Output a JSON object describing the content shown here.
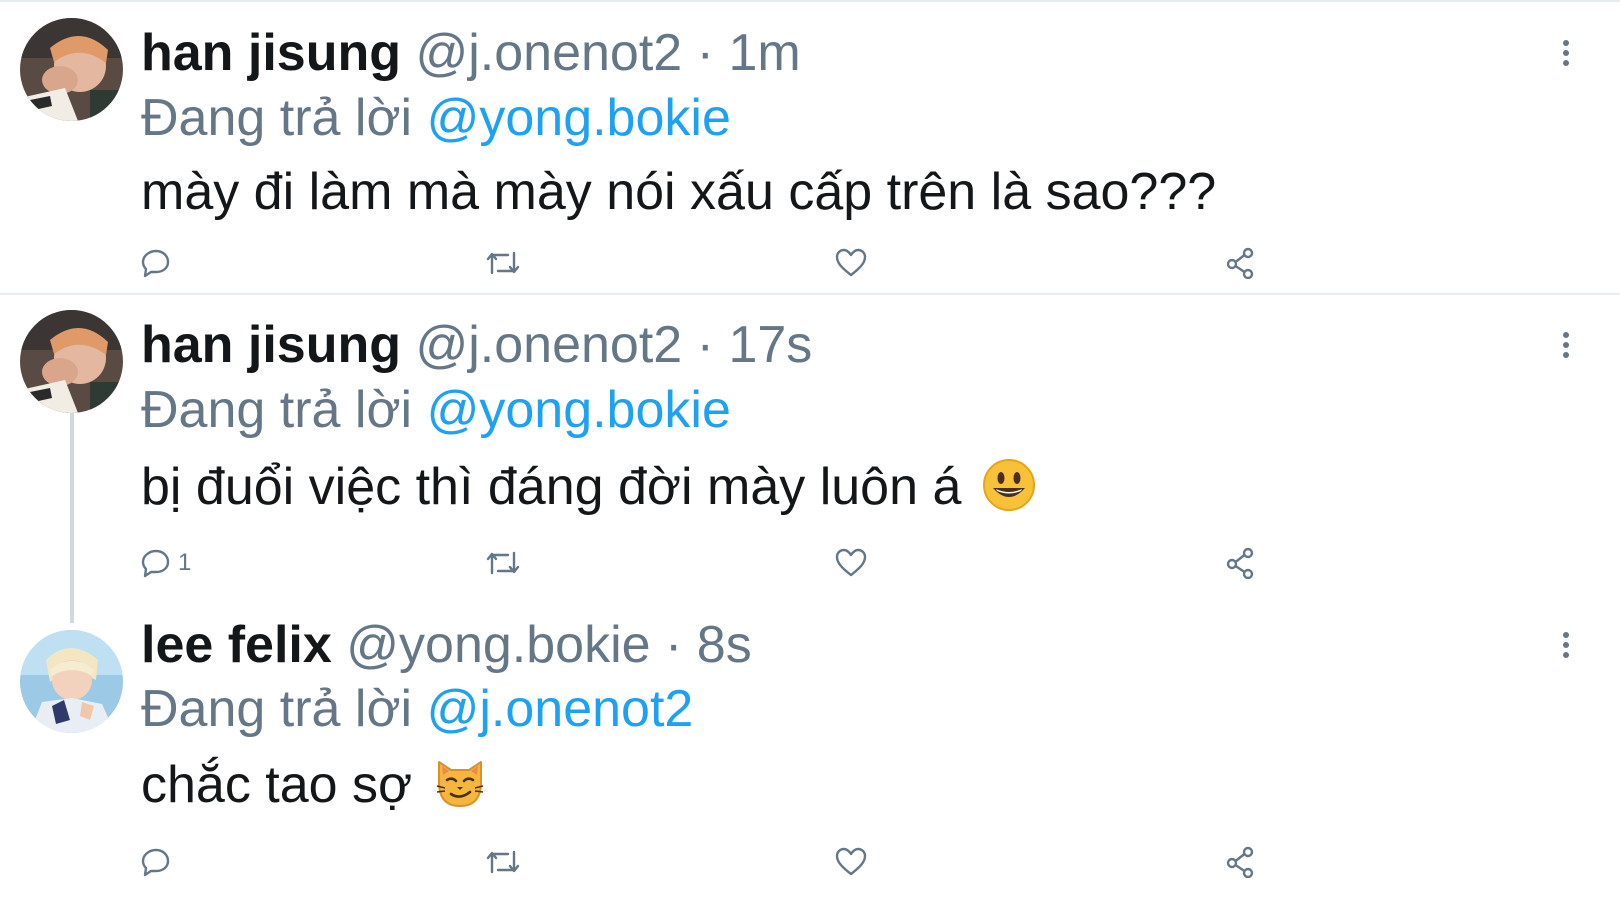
{
  "tweets": [
    {
      "name": "han jisung",
      "handle": "@j.onenot2",
      "separator": "·",
      "time": "1m",
      "reply_prefix": "Đang trả lời",
      "reply_to": "@yong.bokie",
      "text": "mày đi làm mà mày nói xấu cấp trên là sao???",
      "reply_count": "",
      "avatar": "avatar-han-jisung"
    },
    {
      "name": "han jisung",
      "handle": "@j.onenot2",
      "separator": "·",
      "time": "17s",
      "reply_prefix": "Đang trả lời",
      "reply_to": "@yong.bokie",
      "text": "bị đuổi việc thì đáng đời mày luôn á",
      "emoji": "grinning-face-emoji",
      "reply_count": "1",
      "avatar": "avatar-han-jisung"
    },
    {
      "name": "lee felix",
      "handle": "@yong.bokie",
      "separator": "·",
      "time": "8s",
      "reply_prefix": "Đang trả lời",
      "reply_to": "@j.onenot2",
      "text": "chắc tao sợ",
      "emoji": "smirking-cat-emoji",
      "reply_count": "",
      "avatar": "avatar-lee-felix"
    }
  ],
  "icons": {
    "reply": "reply-icon",
    "retweet": "retweet-icon",
    "like": "heart-icon",
    "share": "share-icon",
    "more": "more-vertical-icon"
  },
  "colors": {
    "text": "#14171a",
    "secondary": "#657786",
    "link": "#1da1f2",
    "divider": "#e6ecf0",
    "thread_line": "#cfd9de"
  }
}
